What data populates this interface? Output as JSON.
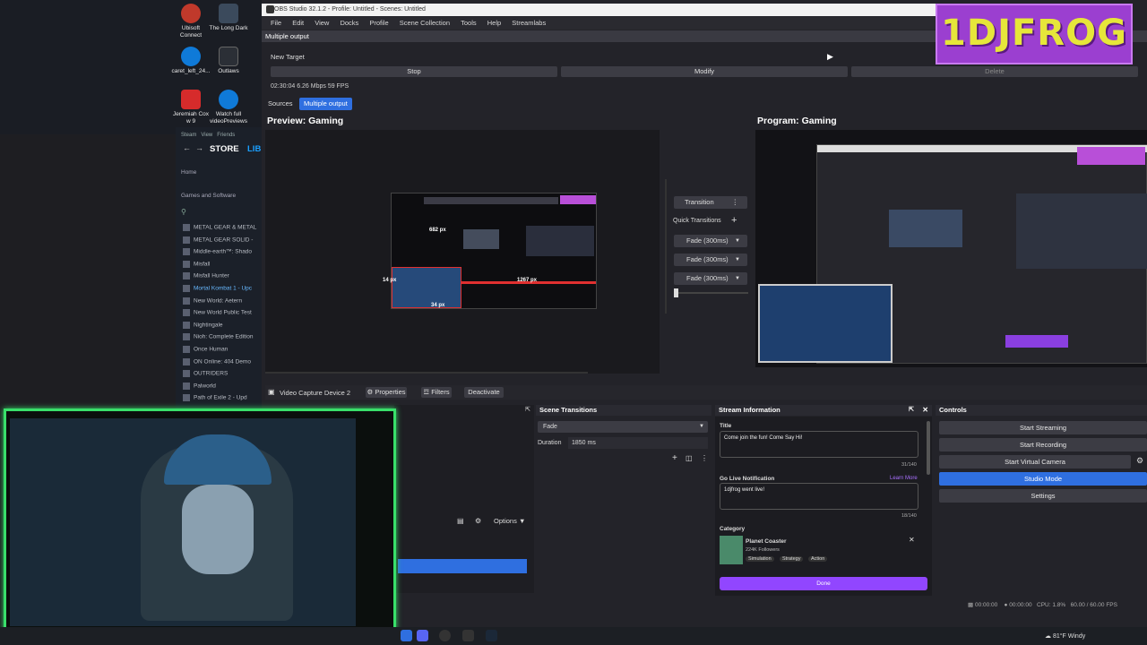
{
  "desktop": {
    "icons": [
      {
        "label": "Ubisoft Connect",
        "color": "#c0392b",
        "icon": "ubisoft-icon"
      },
      {
        "label": "The Long Dark",
        "color": "#3b4a5c",
        "icon": "game-icon"
      },
      {
        "label": "caret_left_24...",
        "color": "#0f7ad8",
        "icon": "edge-icon"
      },
      {
        "label": "Outlaws",
        "color": "#2b2f36",
        "icon": "game-icon"
      },
      {
        "label": "Jeremiah Cox w 9",
        "color": "#d62b2b",
        "icon": "pdf-icon"
      },
      {
        "label": "Watch full videoPreviews",
        "color": "#0f7ad8",
        "icon": "edge-icon"
      }
    ]
  },
  "steam": {
    "menu": [
      "Steam",
      "View",
      "Friends"
    ],
    "store": "STORE",
    "library": "LIB",
    "home": "Home",
    "filter": "Games and Software",
    "games": [
      "METAL GEAR & METAL",
      "METAL GEAR SOLID -",
      "Middle-earth™: Shado",
      "Misfall",
      "Misfall Hunter",
      "Mortal Kombat 1 - Upc",
      "New World: Aetern",
      "New World Public Test",
      "Nightingale",
      "Nioh: Complete Edition",
      "Once Human",
      "ON Online: 404 Demo",
      "OUTRIDERS",
      "Palworld",
      "Path of Exile 2 - Upd"
    ]
  },
  "obs": {
    "title": "OBS Studio 32.1.2 - Profile: Untitled - Scenes: Untitled",
    "menu": [
      "File",
      "Edit",
      "View",
      "Docks",
      "Profile",
      "Scene Collection",
      "Tools",
      "Help",
      "Streamlabs"
    ],
    "multiple_output": {
      "window_title": "Multiple output",
      "target_label": "New Target",
      "stop": "Stop",
      "modify": "Modify",
      "delete": "Delete",
      "stats": "02:30:04  6.26 Mbps  59 FPS"
    },
    "tabs": {
      "sources": "Sources",
      "multiple_output": "Multiple output"
    },
    "preview_title": "Preview: Gaming",
    "program_title": "Program: Gaming",
    "preview_labels": {
      "w": "682 px",
      "left": "14 px",
      "right": "1267 px",
      "bottom": "34 px"
    },
    "transition": {
      "button": "Transition",
      "quick": "Quick Transitions",
      "items": [
        "Fade (300ms)",
        "Fade (300ms)",
        "Fade (300ms)"
      ]
    },
    "source_bar": {
      "source": "Video Capture Device 2",
      "properties": "Properties",
      "filters": "Filters",
      "deactivate": "Deactivate"
    },
    "scene_transitions": {
      "header": "Scene Transitions",
      "value": "Fade",
      "duration_label": "Duration",
      "duration": "1850 ms"
    },
    "options": "Options",
    "stream_info": {
      "header": "Stream Information",
      "title_label": "Title",
      "title_value": "Come join the fun! Come Say Hi!",
      "title_count": "31/140",
      "golive_label": "Go Live Notification",
      "learn_more": "Learn More",
      "golive_value": "1djfrog went live!",
      "golive_count": "18/140",
      "category_label": "Category",
      "category_name": "Planet Coaster",
      "followers": "224K Followers",
      "tags": [
        "Simulation",
        "Strategy",
        "Action"
      ],
      "done": "Done"
    },
    "controls": {
      "header": "Controls",
      "items": [
        "Start Streaming",
        "Start Recording",
        "Start Virtual Camera",
        "Studio Mode",
        "Settings"
      ]
    },
    "status": {
      "time1": "00:00:00",
      "time2": "00:00:00",
      "cpu": "CPU: 1.8%",
      "fps": "60.00 / 60.00 FPS"
    }
  },
  "logo_text": "1DJFROG",
  "taskbar": {
    "weather": "81°F  Windy"
  },
  "colors": {
    "accent": "#2f6fe0",
    "twitch": "#9146ff",
    "webcam_border": "#39e06a",
    "logo": "#e6e63a"
  }
}
